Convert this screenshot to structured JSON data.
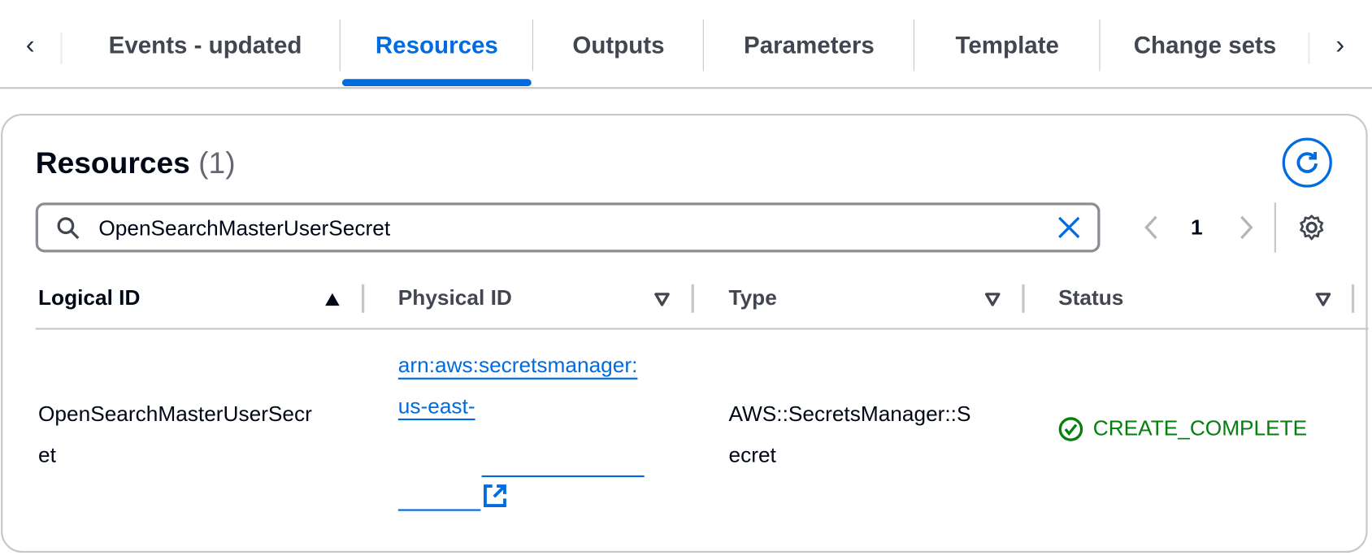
{
  "tabs": [
    {
      "label": "Events - updated",
      "active": false
    },
    {
      "label": "Resources",
      "active": true
    },
    {
      "label": "Outputs",
      "active": false
    },
    {
      "label": "Parameters",
      "active": false
    },
    {
      "label": "Template",
      "active": false
    },
    {
      "label": "Change sets",
      "active": false
    }
  ],
  "panel": {
    "title": "Resources",
    "count": "(1)",
    "search_value": "OpenSearchMasterUserSecret",
    "page": "1"
  },
  "table": {
    "columns": [
      "Logical ID",
      "Physical ID",
      "Type",
      "Status"
    ],
    "rows": [
      {
        "logical_id_line1": "OpenSearchMasterUserSecr",
        "logical_id_line2": "et",
        "physical_id_line1": "arn:aws:secretsmanager:",
        "physical_id_line2": "us-east-",
        "type_line1": "AWS::SecretsManager::S",
        "type_line2": "ecret",
        "status": "CREATE_COMPLETE"
      }
    ]
  },
  "colors": {
    "accent": "#006ce0",
    "success": "#037f0c"
  }
}
